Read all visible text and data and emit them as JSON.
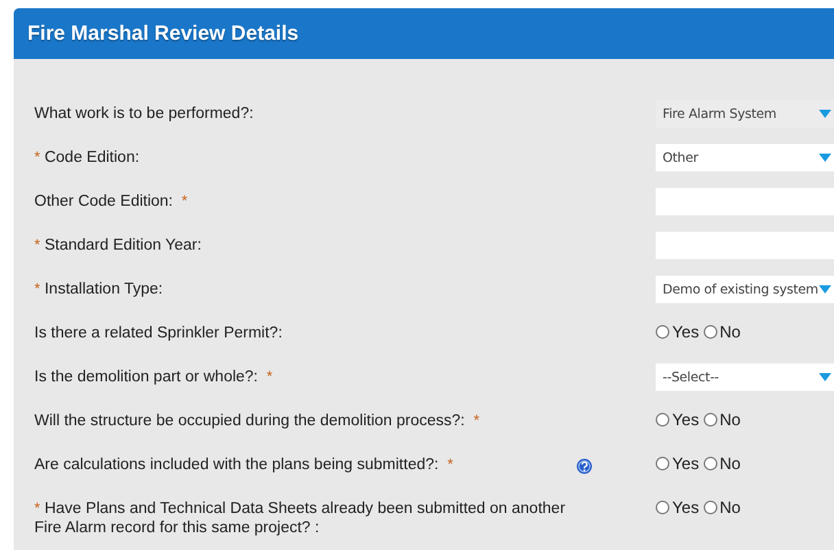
{
  "panel": {
    "title": "Fire Marshal Review Details"
  },
  "fields": [
    {
      "label": "What work is to be performed?:",
      "help": false,
      "kind": "select",
      "value": "Fire Alarm System",
      "disabled": true
    },
    {
      "label": "Code Edition:",
      "required": {
        "kind": "prefix",
        "mark": "*"
      },
      "help": false,
      "kind": "select",
      "value": "Other",
      "disabled": false
    },
    {
      "label": "Other Code Edition:",
      "required": {
        "kind": "suffix",
        "mark": "*"
      },
      "help": false,
      "kind": "text"
    },
    {
      "label": "Standard Edition Year:",
      "required": {
        "kind": "prefix",
        "mark": "*"
      },
      "help": false,
      "kind": "text"
    },
    {
      "label": "Installation Type:",
      "required": {
        "kind": "prefix",
        "mark": "*"
      },
      "help": false,
      "kind": "select",
      "value": "Demo of existing system",
      "disabled": false
    },
    {
      "label": "Is there a related Sprinkler Permit?:",
      "help": false,
      "kind": "radio",
      "options": [
        {
          "label": "Yes",
          "selected": false
        },
        {
          "label": "No",
          "selected": false
        }
      ]
    },
    {
      "label": "Is the demolition part or whole?:",
      "required": {
        "kind": "suffix",
        "mark": "*"
      },
      "help": false,
      "kind": "select",
      "value": "--Select--",
      "disabled": false
    },
    {
      "label": "Will the structure be occupied during the demolition process?:",
      "required": {
        "kind": "suffix",
        "mark": "*"
      },
      "help": false,
      "kind": "radio",
      "options": [
        {
          "label": "Yes",
          "selected": false
        },
        {
          "label": "No",
          "selected": false
        }
      ]
    },
    {
      "label": "Are calculations included with the plans being submitted?:",
      "required": {
        "kind": "suffix",
        "mark": "*"
      },
      "help": true,
      "kind": "radio",
      "options": [
        {
          "label": "Yes",
          "selected": false
        },
        {
          "label": "No",
          "selected": false
        }
      ]
    },
    {
      "label": "Have Plans and Technical Data Sheets already been submitted on another Fire Alarm record for this same project? :",
      "required": {
        "kind": "prefix",
        "mark": "*"
      },
      "help": false,
      "kind": "radio",
      "options": [
        {
          "label": "Yes",
          "selected": false
        },
        {
          "label": "No",
          "selected": false
        }
      ]
    }
  ]
}
